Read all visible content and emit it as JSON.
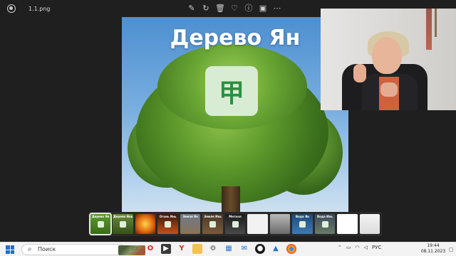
{
  "window": {
    "filename": "1.1.png",
    "toolbar_icons": [
      "edit-icon",
      "rotate-icon",
      "delete-icon",
      "favorite-icon",
      "info-icon",
      "slideshow-icon",
      "more-icon"
    ]
  },
  "slide": {
    "title": "Дерево Ян",
    "glyph": "甲"
  },
  "filmstrip": {
    "thumbnails": [
      {
        "label": "Дерево Ян",
        "selected": true
      },
      {
        "label": "Дерево Инь",
        "selected": false
      },
      {
        "label": "",
        "selected": false
      },
      {
        "label": "Огонь Инь",
        "selected": false
      },
      {
        "label": "Земля Ян",
        "selected": false
      },
      {
        "label": "Земля Инь",
        "selected": false
      },
      {
        "label": "Металл",
        "selected": false
      },
      {
        "label": "",
        "selected": false
      },
      {
        "label": "",
        "selected": false
      },
      {
        "label": "Вода Ян",
        "selected": false
      },
      {
        "label": "Вода Инь",
        "selected": false
      },
      {
        "label": "",
        "selected": false
      },
      {
        "label": "",
        "selected": false
      }
    ]
  },
  "taskbar": {
    "search_placeholder": "Поиск",
    "apps": [
      "task-view-icon",
      "opera-icon",
      "media-player-icon",
      "yandex-icon",
      "file-explorer-icon",
      "settings-icon",
      "store-icon",
      "mail-icon",
      "obs-icon",
      "photos-icon",
      "chrome-icon"
    ],
    "language": "РУС",
    "time": "19:44",
    "date": "08.11.2023"
  }
}
